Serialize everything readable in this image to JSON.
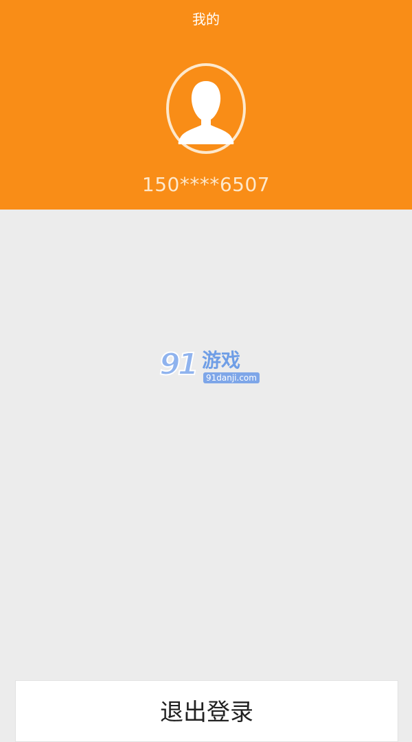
{
  "header": {
    "title": "我的",
    "phone": "150****6507",
    "background_color": "#f98d17",
    "avatar_icon": "user-silhouette-icon"
  },
  "watermark": {
    "number": "91",
    "text": "游戏",
    "domain": "91danji.com"
  },
  "footer": {
    "logout_label": "退出登录"
  }
}
